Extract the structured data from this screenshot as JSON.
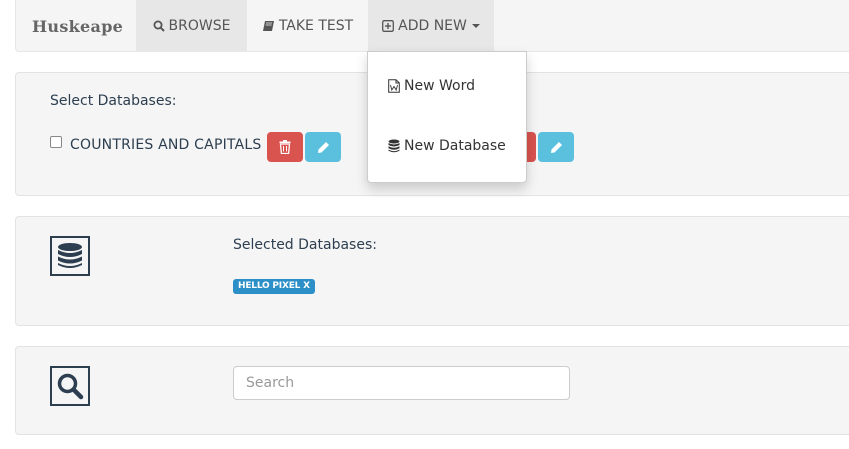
{
  "navbar": {
    "brand": "Huskeape",
    "browse_label": "BROWSE",
    "take_test_label": "TAKE TEST",
    "add_new_label": "ADD NEW"
  },
  "dropdown": {
    "new_word_label": "New Word",
    "new_database_label": "New Database"
  },
  "select_panel": {
    "title": "Select Databases:",
    "databases": [
      {
        "name": "COUNTRIES AND CAPITALS",
        "checked": false
      }
    ]
  },
  "selected_panel": {
    "title": "Selected Databases:",
    "badges": [
      "HELLO PIXEL X"
    ]
  },
  "search": {
    "placeholder": "Search",
    "value": ""
  },
  "colors": {
    "danger": "#d9534f",
    "info": "#5bc0de",
    "badge": "#2c8fc8"
  },
  "icons": [
    "search-icon",
    "book-icon",
    "plus-square-icon",
    "file-word-icon",
    "database-icon",
    "trash-icon",
    "pencil-icon"
  ]
}
